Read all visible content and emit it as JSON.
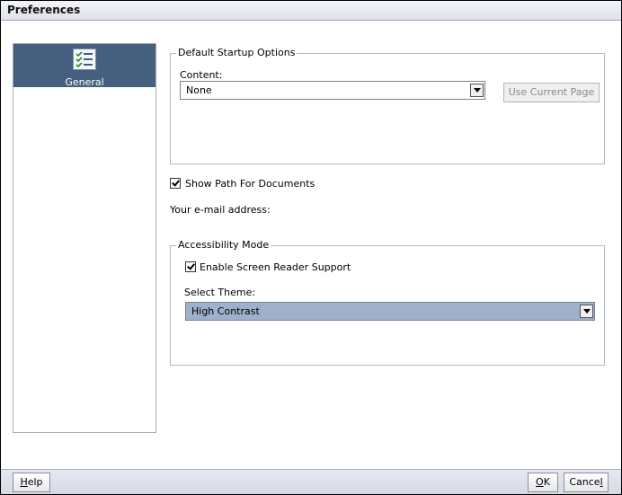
{
  "window": {
    "title": "Preferences"
  },
  "sidebar": {
    "items": [
      {
        "label": "General",
        "icon": "checklist-icon",
        "selected": true
      }
    ]
  },
  "startup": {
    "legend": "Default Startup Options",
    "content_label": "Content:",
    "content_value": "None",
    "use_current_page": "Use Current Page"
  },
  "show_path": {
    "label": "Show Path For Documents",
    "checked": true
  },
  "email": {
    "label": "Your e-mail address:"
  },
  "accessibility": {
    "legend": "Accessibility Mode",
    "screen_reader": {
      "label": "Enable Screen Reader Support",
      "checked": true
    },
    "theme_label": "Select Theme:",
    "theme_value": "High Contrast"
  },
  "footer": {
    "help_prefix": "H",
    "help_suffix": "elp",
    "ok_prefix": "",
    "ok_underlined": "O",
    "ok_suffix": "K",
    "cancel_prefix": "Cance",
    "cancel_underlined": "l"
  },
  "colors": {
    "selected_bg": "#44607e",
    "theme_highlight": "#9fb0cc"
  }
}
